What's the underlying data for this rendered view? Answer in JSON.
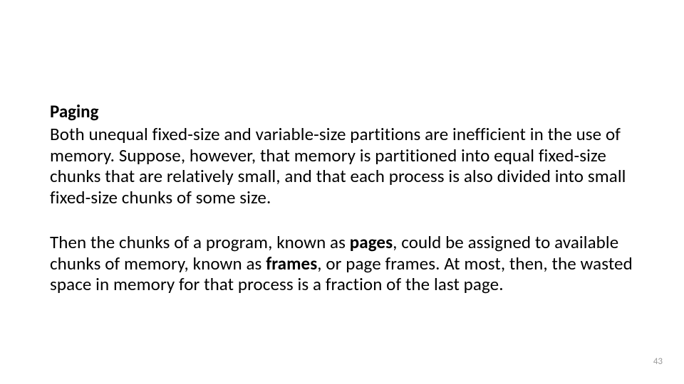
{
  "slide": {
    "heading": "Paging",
    "para1_a": "Both unequal fixed-size and variable-size partitions are inefficient in the use of memory. Suppose, however, that memory is partitioned into equal fixed-size chunks that are relatively small, and that each process is also divided into small fixed-size chunks of some size.",
    "para2_a": "Then the chunks of a program, known as ",
    "para2_b_bold": "pages",
    "para2_c": ", could be assigned to available chunks of memory, known as ",
    "para2_d_bold": "frames",
    "para2_e": ", or page frames. At most, then, the wasted space in memory for that process is a fraction of the last page.",
    "page_number": "43"
  }
}
